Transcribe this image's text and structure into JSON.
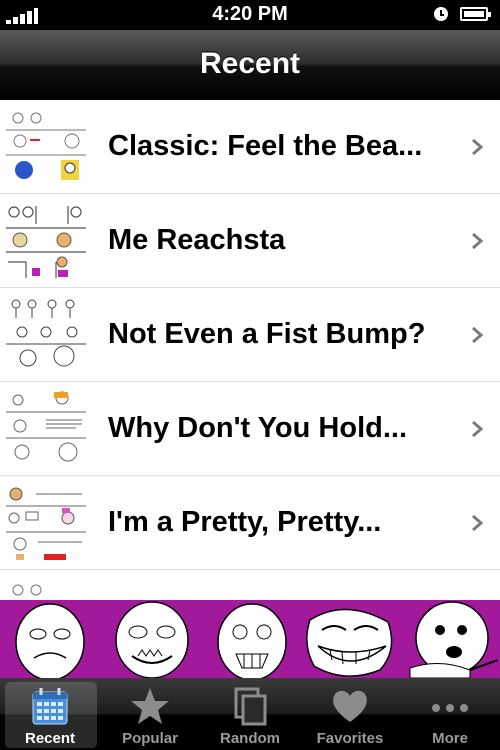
{
  "status_bar": {
    "time": "4:20 PM"
  },
  "nav": {
    "title": "Recent"
  },
  "list": {
    "items": [
      {
        "title": "Classic: Feel the Bea..."
      },
      {
        "title": "Me Reachsta"
      },
      {
        "title": "Not Even a Fist Bump?"
      },
      {
        "title": "Why Don't You Hold..."
      },
      {
        "title": "I'm a Pretty, Pretty..."
      },
      {
        "title": ""
      }
    ]
  },
  "banner": {
    "background": "#a3199b"
  },
  "tab_bar": {
    "tabs": [
      {
        "label": "Recent",
        "icon": "calendar-icon",
        "active": true
      },
      {
        "label": "Popular",
        "icon": "star-icon",
        "active": false
      },
      {
        "label": "Random",
        "icon": "stacked-pages-icon",
        "active": false
      },
      {
        "label": "Favorites",
        "icon": "heart-icon",
        "active": false
      },
      {
        "label": "More",
        "icon": "more-dots-icon",
        "active": false
      }
    ]
  },
  "colors": {
    "tab_active": "#4a90d9",
    "tab_inactive": "#8c8c8c"
  }
}
